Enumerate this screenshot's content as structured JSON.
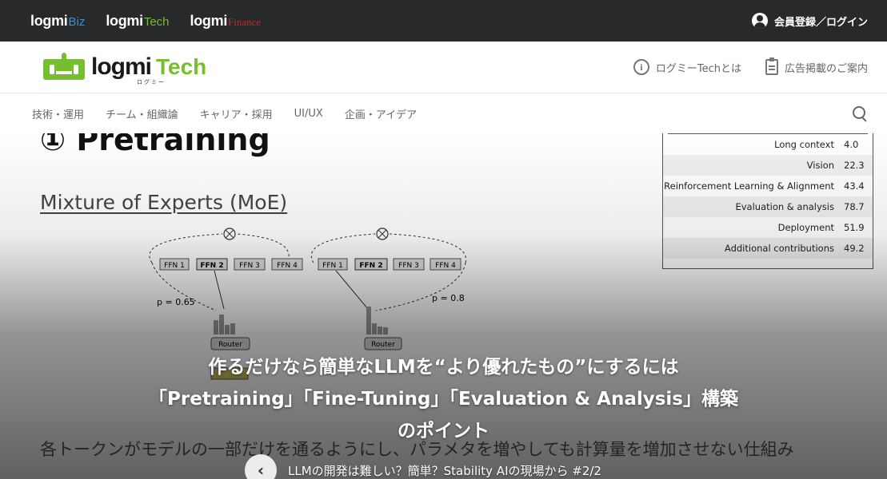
{
  "topbar": {
    "brands": [
      {
        "main": "logmi",
        "sub": "Biz",
        "sub_color": "#3d8fd6"
      },
      {
        "main": "logmi",
        "sub": "Tech",
        "sub_color": "#76bd30"
      },
      {
        "main": "logmi",
        "sub": "Finance",
        "sub_color": "#c62828"
      }
    ],
    "auth_label": "会員登録／ログイン"
  },
  "header": {
    "logo_main": "logmi",
    "logo_accent": "Tech",
    "logo_sub": "ログミー",
    "about_label": "ログミーTechとは",
    "ads_label": "広告掲載のご案内"
  },
  "nav": {
    "items": [
      "技術・運用",
      "チーム・組織論",
      "キャリア・採用",
      "UI/UX",
      "企画・アイデア"
    ]
  },
  "slide": {
    "title": "① Pretraining",
    "subtitle": "Mixture of Experts (MoE)",
    "diagram": {
      "left": {
        "ffn": [
          "FFN 1",
          "FFN 2",
          "FFN 3",
          "FFN 4"
        ],
        "prob": "p = 0.65",
        "router": "Router"
      },
      "right": {
        "ffn": [
          "FFN 1",
          "FFN 2",
          "FFN 3",
          "FFN 4"
        ],
        "prob": "p = 0.8",
        "router": "Router"
      }
    },
    "caption": "各トークンがモデルの一部だけを通るようにし、パラメタを増やしても計算量を増加させない仕組み"
  },
  "table": {
    "rows": [
      {
        "label": "Long context",
        "value": "4.0"
      },
      {
        "label": "Vision",
        "value": "22.3"
      },
      {
        "label": "Reinforcement Learning & Alignment",
        "value": "43.4"
      },
      {
        "label": "Evaluation & analysis",
        "value": "78.7"
      },
      {
        "label": "Deployment",
        "value": "51.9"
      },
      {
        "label": "Additional contributions",
        "value": "49.2"
      }
    ]
  },
  "hero": {
    "line1": "作るだけなら簡単なLLMを“より優れたもの”にするには",
    "line2": "「Pretraining」「Fine-Tuning」「Evaluation & Analysis」構築",
    "line3": "のポイント"
  },
  "series": {
    "back_icon": "chevron-left-icon",
    "label": "LLMの開発は難しい？簡単？Stability AIの現場から #2/2"
  }
}
